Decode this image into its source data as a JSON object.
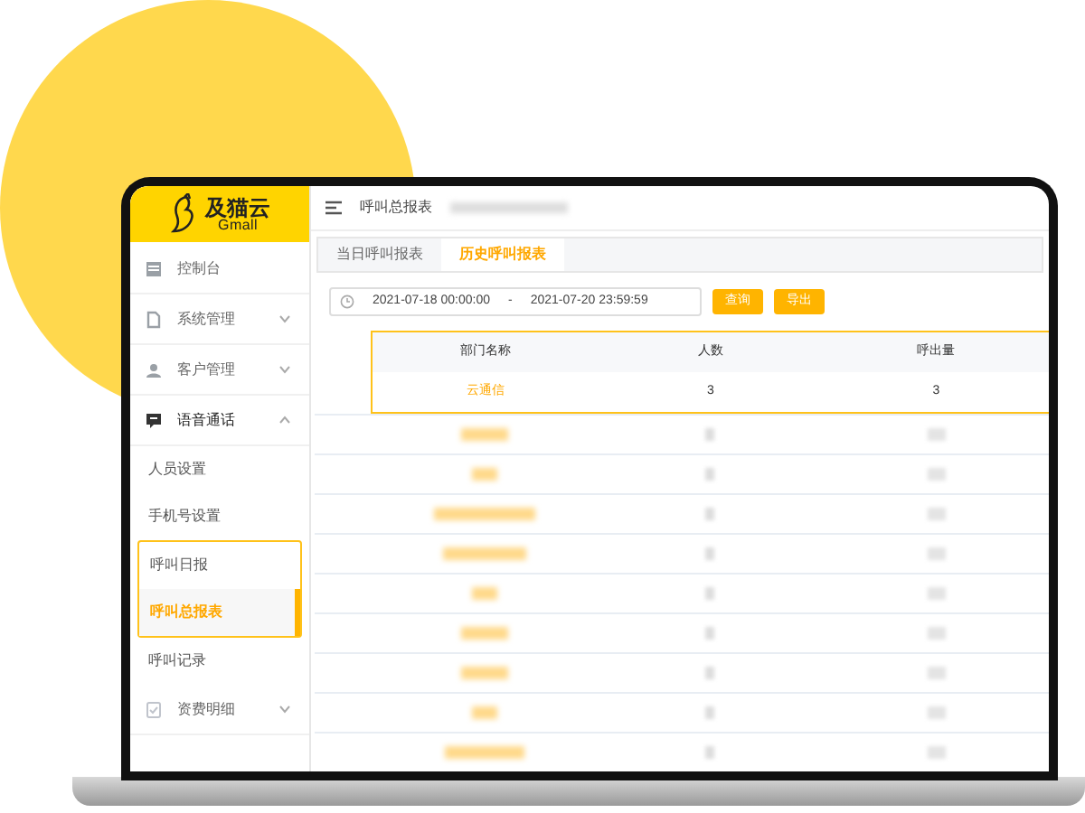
{
  "logo": {
    "name": "及猫云",
    "subtitle": "Gmall"
  },
  "sidebar": {
    "items": [
      {
        "label": "控制台",
        "kind": "link"
      },
      {
        "label": "系统管理",
        "kind": "group",
        "expanded": false
      },
      {
        "label": "客户管理",
        "kind": "group",
        "expanded": false
      },
      {
        "label": "语音通话",
        "kind": "group",
        "expanded": true,
        "children": [
          {
            "label": "人员设置",
            "selected": false,
            "highlighted": false
          },
          {
            "label": "手机号设置",
            "selected": false,
            "highlighted": false
          },
          {
            "label": "呼叫日报",
            "selected": false,
            "highlighted": true
          },
          {
            "label": "呼叫总报表",
            "selected": true,
            "highlighted": true
          },
          {
            "label": "呼叫记录",
            "selected": false,
            "highlighted": false
          }
        ]
      },
      {
        "label": "资费明细",
        "kind": "group",
        "expanded": false
      }
    ]
  },
  "header": {
    "title": "呼叫总报表"
  },
  "tabs": [
    {
      "label": "当日呼叫报表",
      "selected": false
    },
    {
      "label": "历史呼叫报表",
      "selected": true
    }
  ],
  "date_range": {
    "start": "2021-07-18 00:00:00",
    "separator": "-",
    "end": "2021-07-20 23:59:59"
  },
  "buttons": [
    "查询",
    "导出"
  ],
  "table": {
    "highlighted": true,
    "columns": [
      "部门名称",
      "人数",
      "呼出量"
    ],
    "rows": [
      {
        "cells": [
          "云通信",
          "3",
          "3"
        ]
      }
    ]
  }
}
